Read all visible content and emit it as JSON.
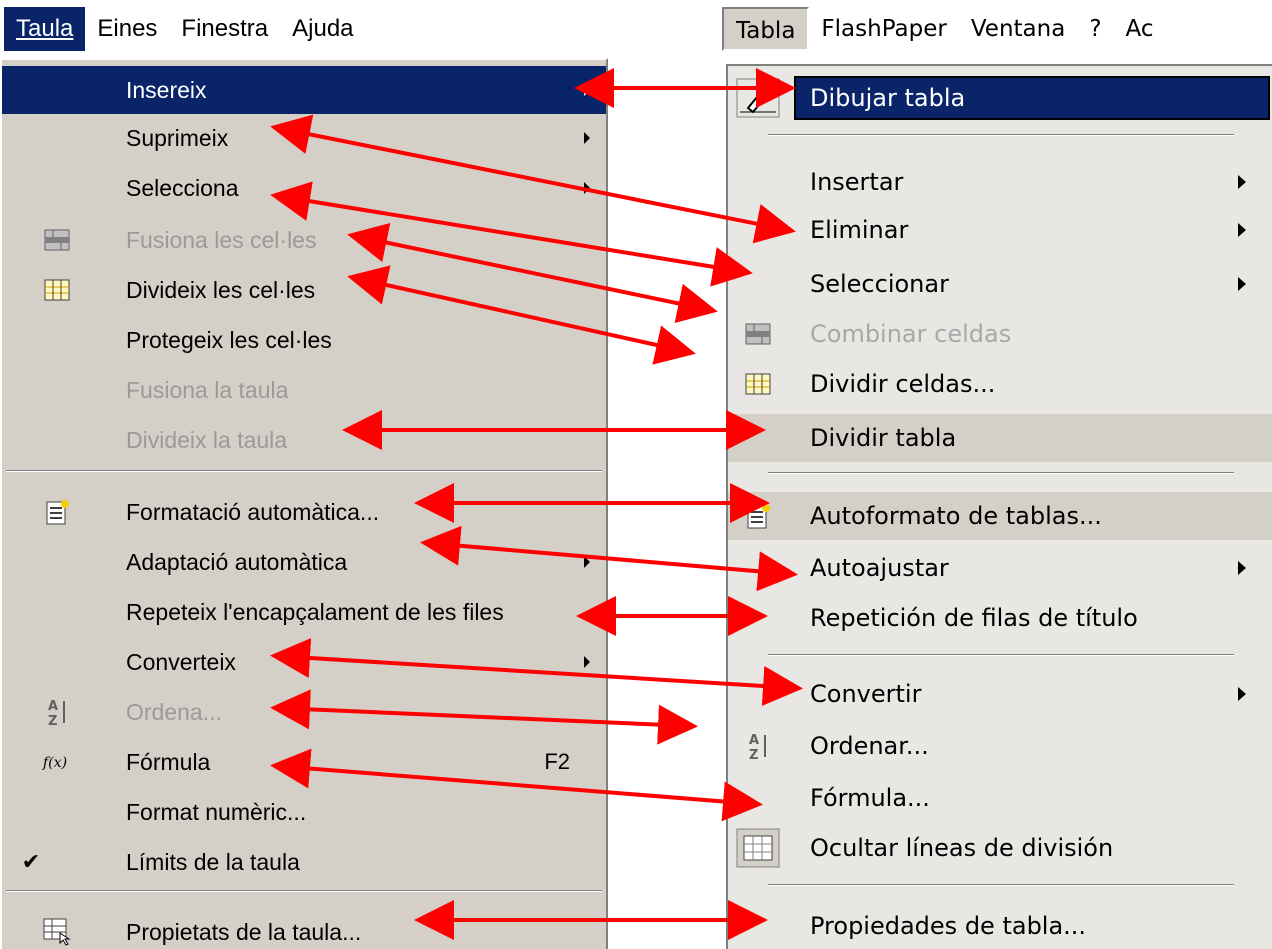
{
  "left": {
    "menubar": [
      "Taula",
      "Eines",
      "Finestra",
      "Ajuda"
    ],
    "items": [
      {
        "label": "Insereix",
        "sub": true,
        "selected": true
      },
      {
        "label": "Suprimeix",
        "sub": true
      },
      {
        "label": "Selecciona",
        "sub": true
      },
      {
        "label": "Fusiona les cel·les",
        "disabled": true,
        "icon": "merge-cells-icon"
      },
      {
        "label": "Divideix les cel·les",
        "icon": "split-cells-icon"
      },
      {
        "label": "Protegeix les cel·les"
      },
      {
        "label": "Fusiona la taula",
        "disabled": true
      },
      {
        "label": "Divideix la taula",
        "disabled": true
      },
      {
        "label": "Formatació automàtica...",
        "icon": "autoformat-icon"
      },
      {
        "label": "Adaptació automàtica",
        "sub": true
      },
      {
        "label": "Repeteix l'encapçalament de les files"
      },
      {
        "label": "Converteix",
        "sub": true
      },
      {
        "label": "Ordena...",
        "disabled": true,
        "icon": "sort-icon"
      },
      {
        "label": "Fórmula",
        "shortcut": "F2",
        "icon": "formula-icon"
      },
      {
        "label": "Format numèric..."
      },
      {
        "label": "Límits de la taula",
        "checked": true
      },
      {
        "label": "Propietats de la taula...",
        "icon": "table-properties-icon"
      }
    ]
  },
  "right": {
    "menubar": [
      "Tabla",
      "FlashPaper",
      "Ventana",
      "?",
      "Ac"
    ],
    "items": [
      {
        "label": "Dibujar tabla",
        "selected": true,
        "icon": "pencil-icon"
      },
      {
        "label": "Insertar",
        "sub": true
      },
      {
        "label": "Eliminar",
        "sub": true
      },
      {
        "label": "Seleccionar",
        "sub": true
      },
      {
        "label": "Combinar celdas",
        "disabled": true,
        "icon": "merge-cells-icon"
      },
      {
        "label": "Dividir celdas...",
        "icon": "split-cells-icon"
      },
      {
        "label": "Dividir tabla"
      },
      {
        "label": "Autoformato de tablas...",
        "icon": "autoformat-icon"
      },
      {
        "label": "Autoajustar",
        "sub": true
      },
      {
        "label": "Repetición de filas de título"
      },
      {
        "label": "Convertir",
        "sub": true
      },
      {
        "label": "Ordenar...",
        "icon": "sort-icon"
      },
      {
        "label": "Fórmula..."
      },
      {
        "label": "Ocultar líneas de división",
        "icon": "gridlines-icon"
      },
      {
        "label": "Propiedades de tabla..."
      }
    ]
  },
  "colors": {
    "arrow": "#ff0000",
    "highlight": "#0a246a"
  }
}
